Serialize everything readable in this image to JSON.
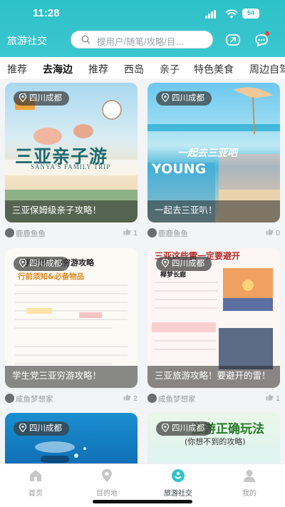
{
  "status": {
    "time": "11:28",
    "battery": "54"
  },
  "header": {
    "app_name": "旅游社交",
    "search_placeholder": "搜用户/随笔/攻略/目…",
    "accent": "#2ec0c8"
  },
  "tabs": [
    "推荐",
    "去海边",
    "推荐",
    "西岛",
    "亲子",
    "特色美食",
    "周边自驾"
  ],
  "posts": [
    {
      "location": "四川成都",
      "title": "三亚保姆级亲子攻略！",
      "author": "鹿鹿鱼鱼",
      "likes": "1",
      "art_text": "三亚亲子游",
      "art_sub": "SANYA'S FAMILY TRIP"
    },
    {
      "location": "四川成都",
      "title": "一起去三亚叭！",
      "author": "鹿鹿鱼鱼",
      "likes": "0",
      "art_text": "一起去三亚吧",
      "art_sub": "YOUNG"
    },
    {
      "location": "四川成都",
      "title": "学生党三亚穷游攻略！",
      "author": "咸鱼梦想家",
      "likes": "2",
      "art_text": "学生党三亚穷游攻略",
      "art_sub": "行前须知&必备物品"
    },
    {
      "location": "四川成都",
      "title": "三亚旅游攻略！要避开的雷！",
      "author": "咸鱼梦想家",
      "likes": "1",
      "art_text": "三亚这些雷一定要避开",
      "art_sub": "椰梦长廊"
    },
    {
      "location": "四川成都",
      "title": "",
      "author": "",
      "likes": "",
      "art_text": "",
      "art_sub": ""
    },
    {
      "location": "四川成都",
      "title": "",
      "author": "",
      "likes": "",
      "art_text": "旅游正确玩法",
      "art_sub": "(你想不到的攻略)"
    }
  ],
  "nav": [
    {
      "label": "首页",
      "icon": "home-icon",
      "active": false
    },
    {
      "label": "目的地",
      "icon": "location-icon",
      "active": false
    },
    {
      "label": "旅游社交",
      "icon": "social-icon",
      "active": true
    },
    {
      "label": "我的",
      "icon": "profile-icon",
      "active": false
    }
  ]
}
